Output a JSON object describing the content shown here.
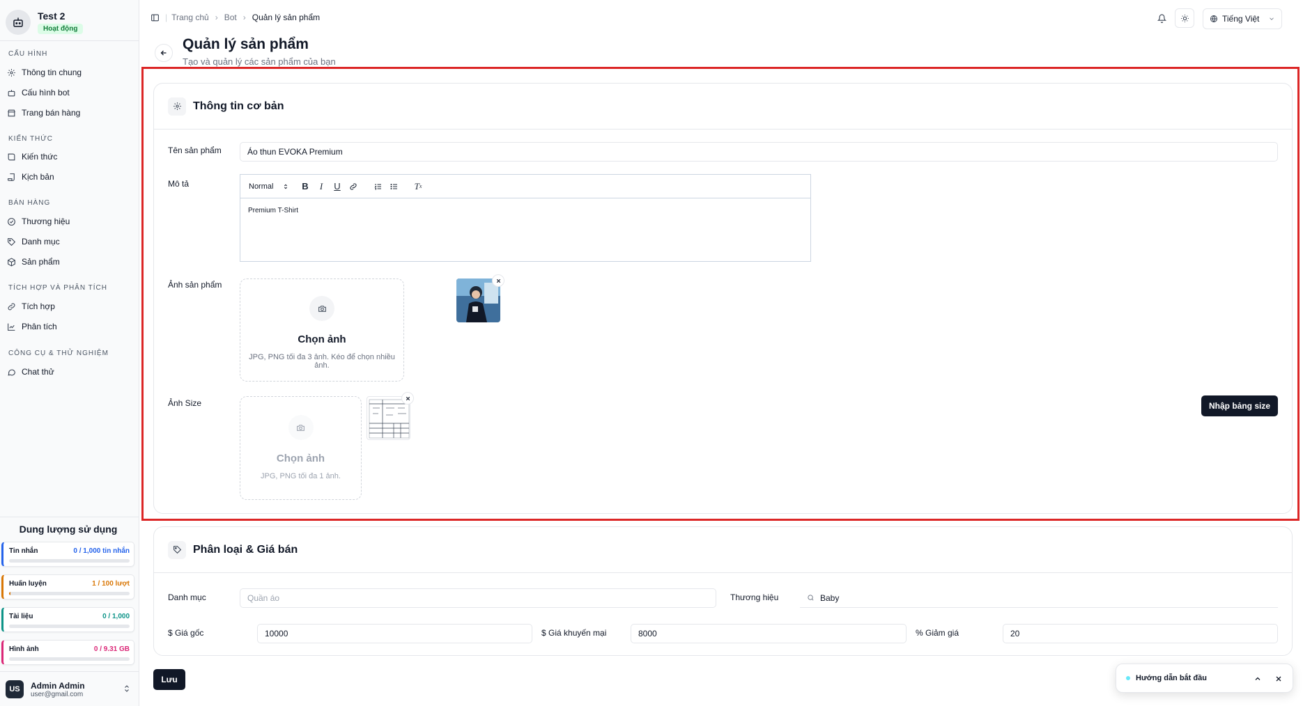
{
  "bot": {
    "name": "Test 2",
    "status": "Hoạt động"
  },
  "sidebar": {
    "groups": [
      {
        "title": "CẤU HÌNH",
        "items": [
          {
            "label": "Thông tin chung",
            "icon": "gear-icon"
          },
          {
            "label": "Cấu hình bot",
            "icon": "bot-icon"
          },
          {
            "label": "Trang bán hàng",
            "icon": "store-icon"
          }
        ]
      },
      {
        "title": "KIẾN THỨC",
        "items": [
          {
            "label": "Kiến thức",
            "icon": "book-icon"
          },
          {
            "label": "Kịch bản",
            "icon": "script-icon"
          }
        ]
      },
      {
        "title": "BÁN HÀNG",
        "items": [
          {
            "label": "Thương hiệu",
            "icon": "badge-check-icon"
          },
          {
            "label": "Danh mục",
            "icon": "tag-icon"
          },
          {
            "label": "Sản phẩm",
            "icon": "box-icon"
          }
        ]
      },
      {
        "title": "TÍCH HỢP VÀ PHÂN TÍCH",
        "items": [
          {
            "label": "Tích hợp",
            "icon": "link-icon"
          },
          {
            "label": "Phân tích",
            "icon": "chart-icon"
          }
        ]
      },
      {
        "title": "CÔNG CỤ & THỬ NGHIỆM",
        "items": [
          {
            "label": "Chat thử",
            "icon": "chat-icon"
          }
        ]
      }
    ]
  },
  "usage": {
    "title": "Dung lượng sử dụng",
    "items": [
      {
        "label": "Tin nhắn",
        "value": "0 / 1,000 tin nhắn",
        "color": "#2563eb",
        "fraction": 0.0
      },
      {
        "label": "Huấn luyện",
        "value": "1 / 100 lượt",
        "color": "#d97706",
        "fraction": 0.01
      },
      {
        "label": "Tài liệu",
        "value": "0 / 1,000",
        "color": "#0d9488",
        "fraction": 0.0
      },
      {
        "label": "Hình ảnh",
        "value": "0 / 9.31 GB",
        "color": "#db2777",
        "fraction": 0.0
      }
    ]
  },
  "user": {
    "initials": "US",
    "name": "Admin Admin",
    "email": "user@gmail.com"
  },
  "breadcrumb": {
    "home": "Trang chủ",
    "bot": "Bot",
    "current": "Quản lý sản phẩm"
  },
  "topbar": {
    "language": "Tiếng Việt"
  },
  "page": {
    "title": "Quản lý sản phẩm",
    "subtitle": "Tạo và quản lý các sản phẩm của bạn"
  },
  "basic": {
    "title": "Thông tin cơ bản",
    "name_label": "Tên sản phẩm",
    "name_value": "Áo thun EVOKA Premium",
    "desc_label": "Mô tả",
    "editor_format": "Normal",
    "desc_value": "Premium T-Shirt",
    "images_label": "Ảnh sản phẩm",
    "images_choose": "Chọn ảnh",
    "images_hint": "JPG, PNG tối đa 3 ảnh. Kéo để chọn nhiều ảnh.",
    "size_label": "Ảnh Size",
    "size_choose": "Chọn ảnh",
    "size_hint": "JPG, PNG tối đa 1 ảnh.",
    "size_table_button": "Nhập bảng size"
  },
  "pricing": {
    "title": "Phân loại & Giá bán",
    "category_label": "Danh mục",
    "category_placeholder": "Quần áo",
    "brand_label": "Thương hiệu",
    "brand_value": "Baby",
    "original_label": "$ Giá gốc",
    "original_value": "10000",
    "promo_label": "$ Giá khuyến mại",
    "promo_value": "8000",
    "discount_label": "% Giảm giá",
    "discount_value": "20"
  },
  "actions": {
    "save": "Lưu"
  },
  "guide": {
    "label": "Hướng dẫn bắt đầu"
  },
  "colors": {
    "accent_dark": "#111827",
    "active_badge_bg": "#dcfce7",
    "highlight": "#dc2626"
  }
}
